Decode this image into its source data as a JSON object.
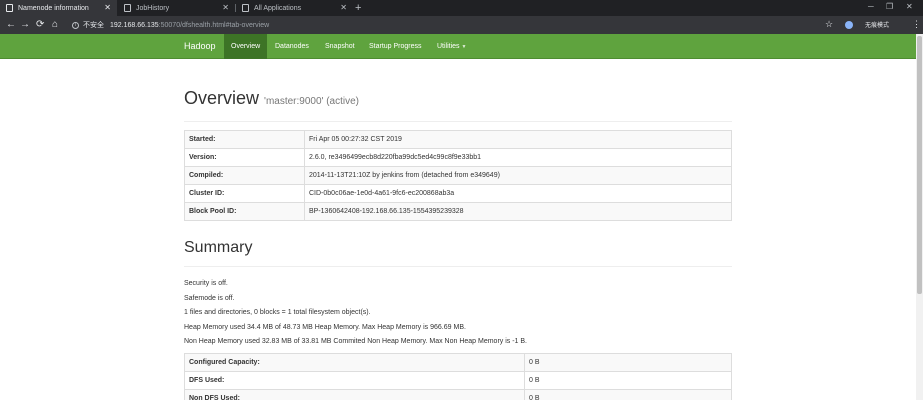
{
  "browser": {
    "tabs": [
      {
        "title": "Namenode information",
        "active": true
      },
      {
        "title": "JobHistory",
        "active": false
      },
      {
        "title": "All Applications",
        "active": false
      }
    ],
    "omnibox": {
      "security_label": "不安全",
      "url_host": "192.168.66.135",
      "url_path": ":50070/dfshealth.html#tab-overview"
    },
    "incognito_label": "无痕模式"
  },
  "navbar": {
    "brand": "Hadoop",
    "items": [
      "Overview",
      "Datanodes",
      "Snapshot",
      "Startup Progress",
      "Utilities"
    ],
    "active_index": 0
  },
  "overview": {
    "title": "Overview",
    "subtitle": "'master:9000' (active)",
    "rows": [
      {
        "label": "Started:",
        "value": "Fri Apr 05 00:27:32 CST 2019"
      },
      {
        "label": "Version:",
        "value": "2.6.0, re3496499ecb8d220fba99dc5ed4c99c8f9e33bb1"
      },
      {
        "label": "Compiled:",
        "value": "2014-11-13T21:10Z by jenkins from (detached from e349649)"
      },
      {
        "label": "Cluster ID:",
        "value": "CID-0b0c06ae-1e0d-4a61-9fc6-ec200868ab3a"
      },
      {
        "label": "Block Pool ID:",
        "value": "BP-1360642408-192.168.66.135-1554395239328"
      }
    ]
  },
  "summary": {
    "title": "Summary",
    "lines": [
      "Security is off.",
      "Safemode is off.",
      "1 files and directories, 0 blocks = 1 total filesystem object(s).",
      "Heap Memory used 34.4 MB of 48.73 MB Heap Memory. Max Heap Memory is 966.69 MB.",
      "Non Heap Memory used 32.83 MB of 33.81 MB Commited Non Heap Memory. Max Non Heap Memory is -1 B."
    ],
    "rows": [
      {
        "label": "Configured Capacity:",
        "value": "0 B"
      },
      {
        "label": "DFS Used:",
        "value": "0 B"
      },
      {
        "label": "Non DFS Used:",
        "value": "0 B"
      }
    ]
  }
}
